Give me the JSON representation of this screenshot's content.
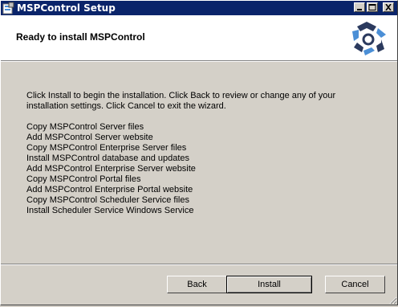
{
  "window": {
    "title": "MSPControl Setup"
  },
  "header": {
    "title": "Ready to install MSPControl"
  },
  "body": {
    "intro": "Click Install to begin the installation. Click Back to review or change any of your installation settings. Click Cancel to exit the wizard.",
    "steps": [
      "Copy MSPControl Server files",
      "Add MSPControl Server website",
      "Copy MSPControl Enterprise Server files",
      "Install MSPControl database and updates",
      "Add MSPControl Enterprise Server website",
      "Copy MSPControl Portal files",
      "Add MSPControl Enterprise Portal website",
      "Copy MSPControl Scheduler Service files",
      "Install Scheduler Service Windows Service"
    ]
  },
  "buttons": {
    "back": "Back",
    "install": "Install",
    "cancel": "Cancel"
  },
  "icons": {
    "app": "setup-app-icon",
    "logo": "mspcontrol-logo-icon",
    "minimize": "minimize-icon",
    "maximize": "maximize-icon",
    "close": "close-icon"
  },
  "colors": {
    "titlebar": "#0a246a",
    "dialog_bg": "#d4d0c8",
    "logo_dark": "#2b3a5e",
    "logo_light": "#4b8fd6"
  }
}
